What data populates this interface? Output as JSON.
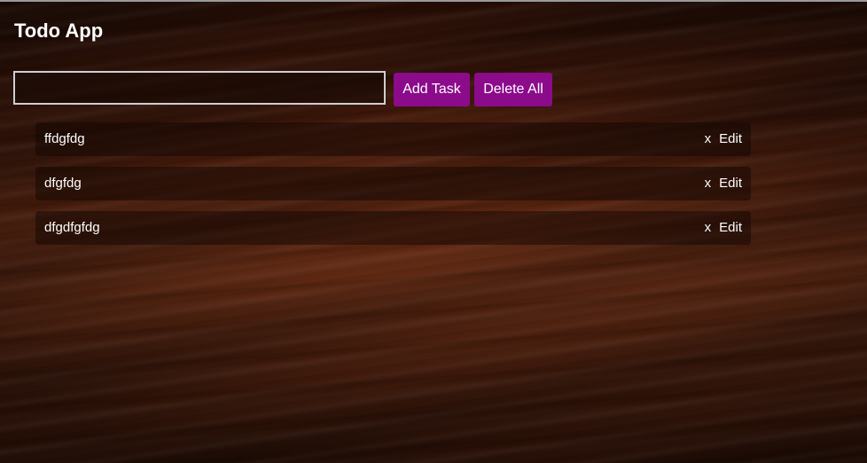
{
  "app": {
    "title": "Todo App"
  },
  "form": {
    "input_value": "",
    "input_placeholder": "",
    "add_label": "Add Task",
    "delete_all_label": "Delete All"
  },
  "tasks": [
    {
      "text": "ffdgfdg",
      "delete_label": "x",
      "edit_label": "Edit"
    },
    {
      "text": "dfgfdg",
      "delete_label": "x",
      "edit_label": "Edit"
    },
    {
      "text": "dfgdfgfdg",
      "delete_label": "x",
      "edit_label": "Edit"
    }
  ],
  "colors": {
    "button_bg": "#8b0b8b",
    "text": "#ffffff",
    "background": "#5a2410"
  }
}
